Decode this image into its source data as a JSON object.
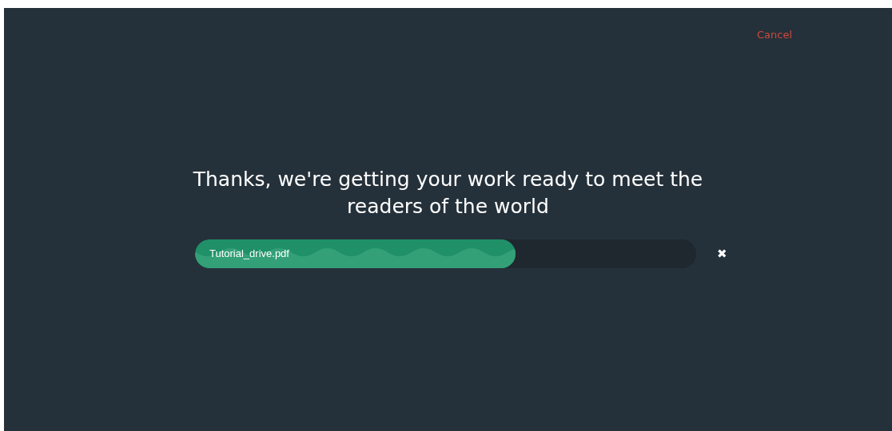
{
  "cancel_link": "Cancel",
  "heading": "Thanks, we're getting your work ready to meet the readers of the world",
  "upload": {
    "file_name": "Tutorial_drive.pdf",
    "level": 0.64,
    "close": "✖"
  }
}
